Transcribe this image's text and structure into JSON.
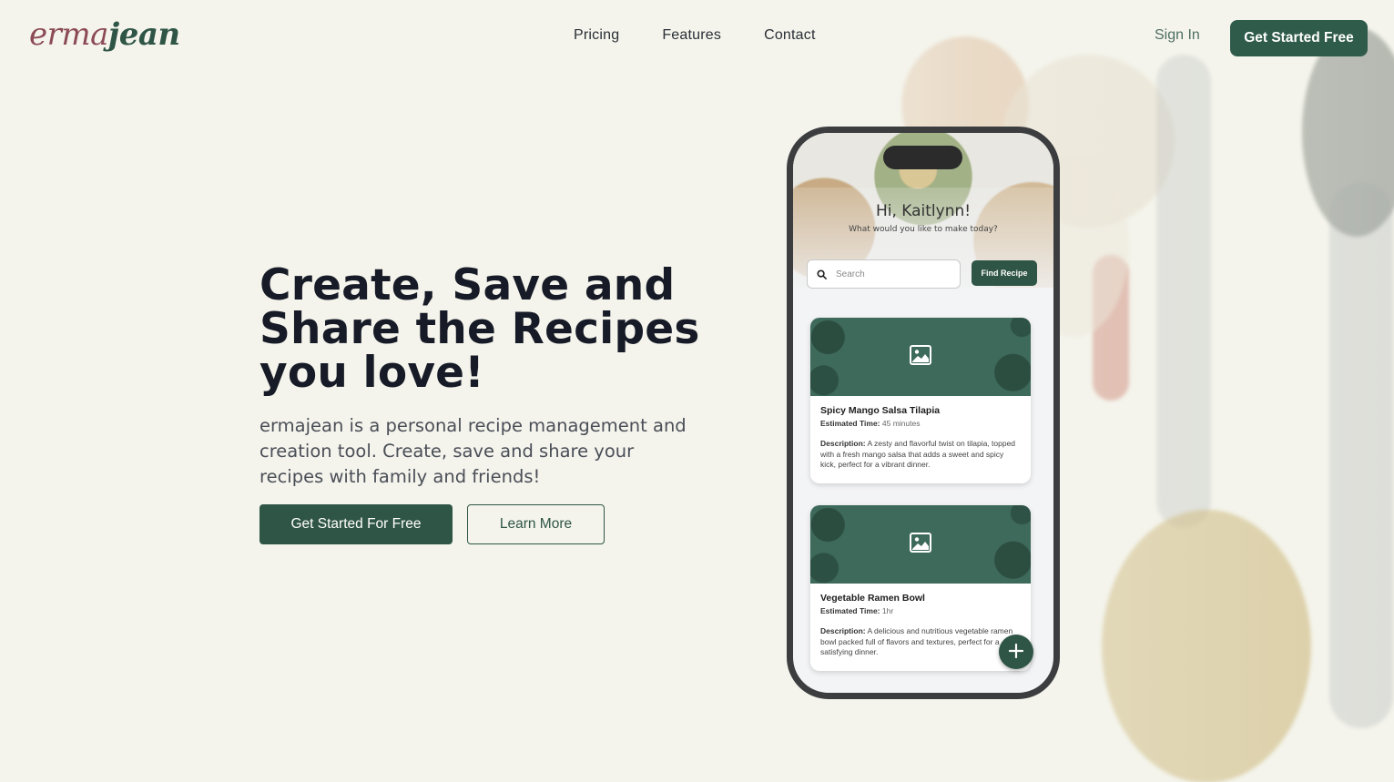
{
  "brand": {
    "logo_part1": "erma",
    "logo_part2": "jean",
    "primary_color": "#2f5546",
    "logo_accent_color": "#8c4a55"
  },
  "nav": {
    "items": [
      {
        "label": "Pricing"
      },
      {
        "label": "Features"
      },
      {
        "label": "Contact"
      }
    ],
    "sign_in": "Sign In",
    "cta": "Get Started Free"
  },
  "hero": {
    "title": "Create, Save and Share the Recipes you love!",
    "subtitle": "ermajean is a personal recipe management and creation tool. Create, save and share your recipes with family and friends!",
    "primary_button": "Get Started For Free",
    "secondary_button": "Learn More"
  },
  "phone": {
    "greeting": "Hi, Kaitlynn!",
    "greeting_sub": "What would you like to make today?",
    "search_placeholder": "Search",
    "find_button": "Find Recipe",
    "recipes": [
      {
        "title": "Spicy Mango Salsa Tilapia",
        "time_label": "Estimated Time:",
        "time": "45 minutes",
        "desc_label": "Description:",
        "desc": "A zesty and flavorful twist on tilapia, topped with a fresh mango salsa that adds a sweet and spicy kick, perfect for a vibrant dinner."
      },
      {
        "title": "Vegetable Ramen Bowl",
        "time_label": "Estimated Time:",
        "time": "1hr",
        "desc_label": "Description:",
        "desc": "A delicious and nutritious vegetable ramen bowl packed full of flavors and textures, perfect for a satisfying dinner."
      }
    ],
    "icons": {
      "search": "search-icon",
      "image": "image-placeholder-icon",
      "add": "plus-icon"
    }
  }
}
